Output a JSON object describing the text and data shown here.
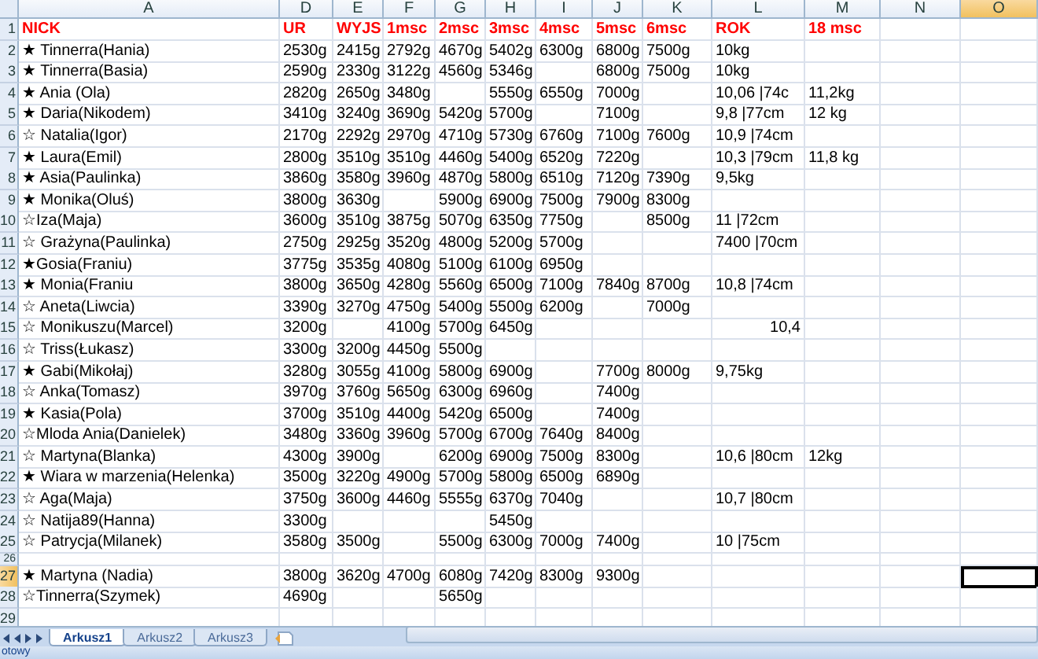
{
  "columns": [
    {
      "label": "A",
      "selected": false
    },
    {
      "label": "D",
      "selected": false
    },
    {
      "label": "E",
      "selected": false
    },
    {
      "label": "F",
      "selected": false
    },
    {
      "label": "G",
      "selected": false
    },
    {
      "label": "H",
      "selected": false
    },
    {
      "label": "I",
      "selected": false
    },
    {
      "label": "J",
      "selected": false
    },
    {
      "label": "K",
      "selected": false
    },
    {
      "label": "L",
      "selected": false
    },
    {
      "label": "M",
      "selected": false
    },
    {
      "label": "N",
      "selected": false
    },
    {
      "label": "O",
      "selected": true
    }
  ],
  "rows": [
    {
      "number": "1",
      "kind": "header",
      "selected": false,
      "cells": [
        "NICK",
        "UR",
        "WYJS",
        "1msc",
        "2msc",
        "3msc",
        "4msc",
        "5msc",
        "6msc",
        "ROK",
        "18 msc"
      ]
    },
    {
      "number": "2",
      "kind": "data",
      "selected": false,
      "cells": [
        "★ Tinnerra(Hania)",
        "2530g",
        "2415g",
        "2792g",
        "4670g",
        "5402g",
        "6300g",
        "6800g",
        "7500g",
        "10kg"
      ]
    },
    {
      "number": "3",
      "kind": "data",
      "selected": false,
      "cells": [
        "★ Tinnerra(Basia)",
        "2590g",
        "2330g",
        "3122g",
        "4560g",
        "5346g",
        null,
        "6800g",
        "7500g",
        "10kg"
      ]
    },
    {
      "number": "4",
      "kind": "data",
      "selected": false,
      "cells": [
        "★ Ania (Ola)",
        "2820g",
        "2650g",
        "3480g",
        null,
        "5550g",
        "6550g",
        "7000g",
        null,
        "10,06 |74c",
        "11,2kg"
      ]
    },
    {
      "number": "5",
      "kind": "data",
      "selected": false,
      "cells": [
        "★ Daria(Nikodem)",
        "3410g",
        "3240g",
        "3690g",
        "5420g",
        "5700g",
        null,
        "7100g",
        null,
        "9,8 |77cm",
        "12 kg"
      ]
    },
    {
      "number": "6",
      "kind": "data",
      "selected": false,
      "cells": [
        "☆ Natalia(Igor)",
        "2170g",
        "2292g",
        "2970g",
        "4710g",
        "5730g",
        "6760g",
        "7100g",
        "7600g",
        "10,9 |74cm"
      ]
    },
    {
      "number": "7",
      "kind": "data",
      "selected": false,
      "cells": [
        "★ Laura(Emil)",
        "2800g",
        "3510g",
        "3510g",
        "4460g",
        "5400g",
        "6520g",
        "7220g",
        null,
        "10,3 |79cm",
        "11,8 kg"
      ]
    },
    {
      "number": "8",
      "kind": "data",
      "selected": false,
      "cells": [
        "★ Asia(Paulinka)",
        "3860g",
        "3580g",
        "3960g",
        "4870g",
        "5800g",
        "6510g",
        "7120g",
        "7390g",
        "9,5kg"
      ]
    },
    {
      "number": "9",
      "kind": "data",
      "selected": false,
      "cells": [
        "★ Monika(Oluś)",
        "3800g",
        "3630g",
        null,
        "5900g",
        "6900g",
        "7500g",
        "7900g",
        "8300g"
      ]
    },
    {
      "number": "10",
      "kind": "data",
      "selected": false,
      "cells": [
        "☆Iza(Maja)",
        "3600g",
        "3510g",
        "3875g",
        "5070g",
        "6350g",
        "7750g",
        null,
        "8500g",
        "11 |72cm"
      ]
    },
    {
      "number": "11",
      "kind": "data",
      "selected": false,
      "cells": [
        "☆ Grażyna(Paulinka)",
        "2750g",
        "2925g",
        "3520g",
        "4800g",
        "5200g",
        "5700g",
        null,
        null,
        "7400 |70cm"
      ]
    },
    {
      "number": "12",
      "kind": "data",
      "selected": false,
      "cells": [
        "★Gosia(Franiu)",
        "3775g",
        "3535g",
        "4080g",
        "5100g",
        "6100g",
        "6950g"
      ]
    },
    {
      "number": "13",
      "kind": "data",
      "selected": false,
      "cells": [
        "★ Monia(Franiu",
        "3800g",
        "3650g",
        "4280g",
        "5560g",
        "6500g",
        "7100g",
        "7840g",
        "8700g",
        "10,8 |74cm"
      ]
    },
    {
      "number": "14",
      "kind": "data",
      "selected": false,
      "cells": [
        "☆ Aneta(Liwcia)",
        "3390g",
        "3270g",
        "4750g",
        "5400g",
        "5500g",
        "6200g",
        null,
        "7000g"
      ]
    },
    {
      "number": "15",
      "kind": "data",
      "selected": false,
      "cells": [
        "☆ Monikuszu(Marcel)",
        "3200g",
        null,
        "4100g",
        "5700g",
        "6450g",
        null,
        null,
        null,
        {
          "text": "10,4",
          "kind": "number"
        }
      ]
    },
    {
      "number": "16",
      "kind": "data",
      "selected": false,
      "cells": [
        "☆ Triss(Łukasz)",
        "3300g",
        "3200g",
        "4450g",
        "5500g"
      ]
    },
    {
      "number": "17",
      "kind": "data",
      "selected": false,
      "cells": [
        "★ Gabi(Mikołaj)",
        "3280g",
        "3055g",
        "4100g",
        "5800g",
        "6900g",
        null,
        "7700g",
        "8000g",
        "9,75kg"
      ]
    },
    {
      "number": "18",
      "kind": "data",
      "selected": false,
      "cells": [
        "☆ Anka(Tomasz)",
        "3970g",
        "3760g",
        "5650g",
        "6300g",
        "6960g",
        null,
        "7400g"
      ]
    },
    {
      "number": "19",
      "kind": "data",
      "selected": false,
      "cells": [
        "★ Kasia(Pola)",
        "3700g",
        "3510g",
        "4400g",
        "5420g",
        "6500g",
        null,
        "7400g"
      ]
    },
    {
      "number": "20",
      "kind": "data",
      "selected": false,
      "cells": [
        "☆Mloda Ania(Danielek)",
        "3480g",
        "3360g",
        "3960g",
        "5700g",
        "6700g",
        "7640g",
        "8400g"
      ]
    },
    {
      "number": "21",
      "kind": "data",
      "selected": false,
      "cells": [
        "☆ Martyna(Blanka)",
        "4300g",
        "3900g",
        null,
        "6200g",
        "6900g",
        "7500g",
        "8300g",
        null,
        "10,6 |80cm",
        "12kg"
      ]
    },
    {
      "number": "22",
      "kind": "data",
      "selected": false,
      "cells": [
        "★ Wiara w marzenia(Helenka)",
        "3500g",
        "3220g",
        "4900g",
        "5700g",
        "5800g",
        "6500g",
        "6890g"
      ]
    },
    {
      "number": "23",
      "kind": "data",
      "selected": false,
      "cells": [
        "☆ Aga(Maja)",
        "3750g",
        "3600g",
        "4460g",
        "5555g",
        "6370g",
        "7040g",
        null,
        null,
        "10,7 |80cm"
      ]
    },
    {
      "number": "24",
      "kind": "data",
      "selected": false,
      "cells": [
        "☆ Natija89(Hanna)",
        "3300g",
        null,
        null,
        null,
        "5450g"
      ]
    },
    {
      "number": "25",
      "kind": "data",
      "selected": false,
      "cells": [
        "☆ Patrycja(Milanek)",
        "3580g",
        "3500g",
        null,
        "5500g",
        "6300g",
        "7000g",
        "7400g",
        null,
        "10 |75cm"
      ]
    },
    {
      "number": "26",
      "kind": "spacer",
      "selected": false
    },
    {
      "number": "27",
      "kind": "data",
      "selected": true,
      "cells": [
        "★ Martyna (Nadia)",
        "3800g",
        "3620g",
        "4700g",
        "6080g",
        "7420g",
        "8300g",
        "9300g"
      ]
    },
    {
      "number": "28",
      "kind": "data",
      "selected": false,
      "cells": [
        "☆Tinnerra(Szymek)",
        "4690g",
        null,
        null,
        "5650g"
      ]
    },
    {
      "number": "29",
      "kind": "data",
      "selected": false
    }
  ],
  "sheet_tabs": [
    {
      "label": "Arkusz1",
      "selected": true
    },
    {
      "label": "Arkusz2",
      "selected": false
    },
    {
      "label": "Arkusz3",
      "selected": false
    }
  ],
  "status_bar": {
    "text": "otowy"
  }
}
